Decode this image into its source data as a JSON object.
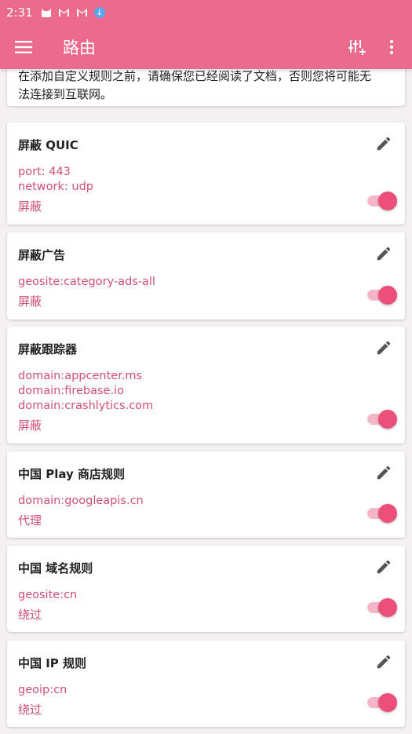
{
  "status_bar": {
    "time": "2:31",
    "icons": [
      "cat-icon",
      "gmail-icon",
      "gmail-icon",
      "download-icon"
    ]
  },
  "app_bar": {
    "title": "路由",
    "menu_icon": "hamburger-icon",
    "actions": [
      "add-rule-icon",
      "more-vert-icon"
    ]
  },
  "notice": {
    "text_line1": "在添加自定义规则之前，请确保您已经阅读了文档，否则您将可能无",
    "text_line2": "法连接到互联网。"
  },
  "rules": [
    {
      "title": "屏蔽 QUIC",
      "lines": [
        "port: 443",
        "network: udp"
      ],
      "action": "屏蔽",
      "enabled": true
    },
    {
      "title": "屏蔽广告",
      "lines": [
        "geosite:category-ads-all"
      ],
      "action": "屏蔽",
      "enabled": true
    },
    {
      "title": "屏蔽跟踪器",
      "lines": [
        "domain:appcenter.ms",
        "domain:firebase.io",
        "domain:crashlytics.com"
      ],
      "action": "屏蔽",
      "enabled": true
    },
    {
      "title": "中国 Play 商店规则",
      "lines": [
        "domain:googleapis.cn"
      ],
      "action": "代理",
      "enabled": true
    },
    {
      "title": "中国 域名规则",
      "lines": [
        "geosite:cn"
      ],
      "action": "绕过",
      "enabled": true
    },
    {
      "title": "中国 IP 规则",
      "lines": [
        "geoip:cn"
      ],
      "action": "绕过",
      "enabled": true
    }
  ],
  "colors": {
    "primary": "#ec6b8c",
    "accent": "#ec4f7a",
    "rule_text": "#d24f74"
  }
}
